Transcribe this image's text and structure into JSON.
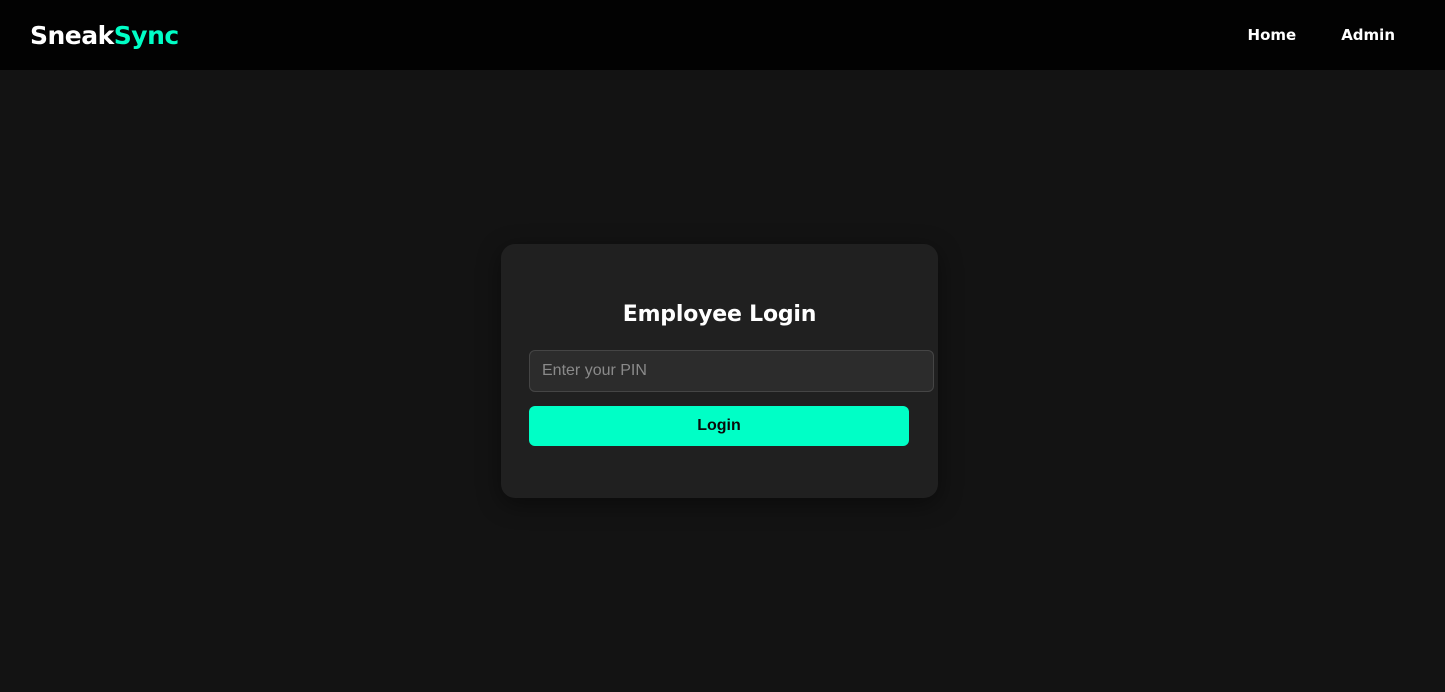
{
  "navbar": {
    "brand": {
      "part1": "Sneak",
      "part2": "Sync"
    },
    "links": [
      {
        "label": "Home"
      },
      {
        "label": "Admin"
      }
    ]
  },
  "login": {
    "title": "Employee Login",
    "pin_placeholder": "Enter your PIN",
    "pin_value": "",
    "button_label": "Login"
  },
  "colors": {
    "accent": "#00ffc6",
    "navbar_bg": "#020202",
    "page_bg": "#131313",
    "card_bg": "#202020",
    "input_bg": "#2c2c2c"
  }
}
